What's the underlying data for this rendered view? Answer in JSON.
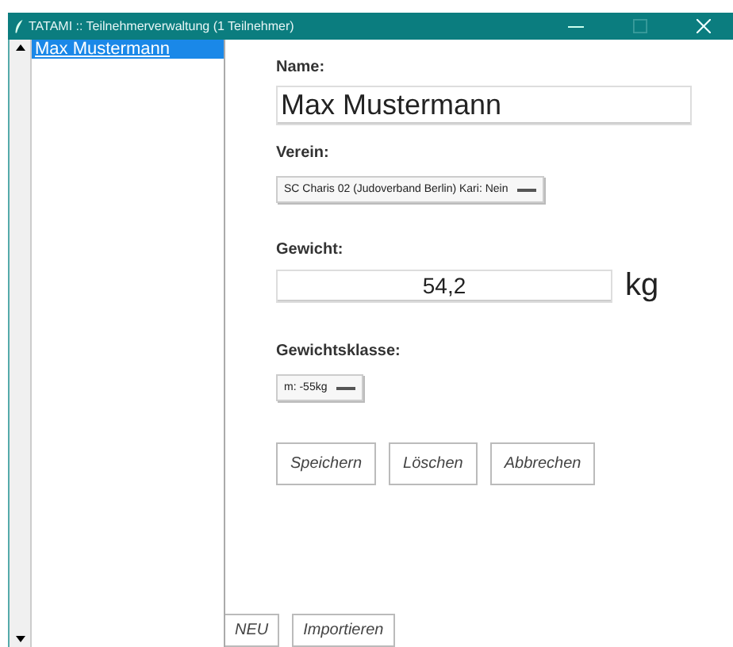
{
  "window": {
    "title": "TATAMI :: Teilnehmerverwaltung (1 Teilnehmer)"
  },
  "participants": [
    {
      "name": "Max Mustermann",
      "selected": true
    }
  ],
  "form": {
    "name_label": "Name:",
    "name_value": "Max Mustermann",
    "club_label": "Verein:",
    "club_value": "SC Charis 02  (Judoverband Berlin)  Kari: Nein",
    "weight_label": "Gewicht:",
    "weight_value": "54,2",
    "weight_unit": "kg",
    "class_label": "Gewichtsklasse:",
    "class_value": "m: -55kg"
  },
  "buttons": [
    "Speichern",
    "Löschen",
    "Abbrechen"
  ],
  "bottom_buttons": [
    "NEU",
    "Importieren"
  ]
}
